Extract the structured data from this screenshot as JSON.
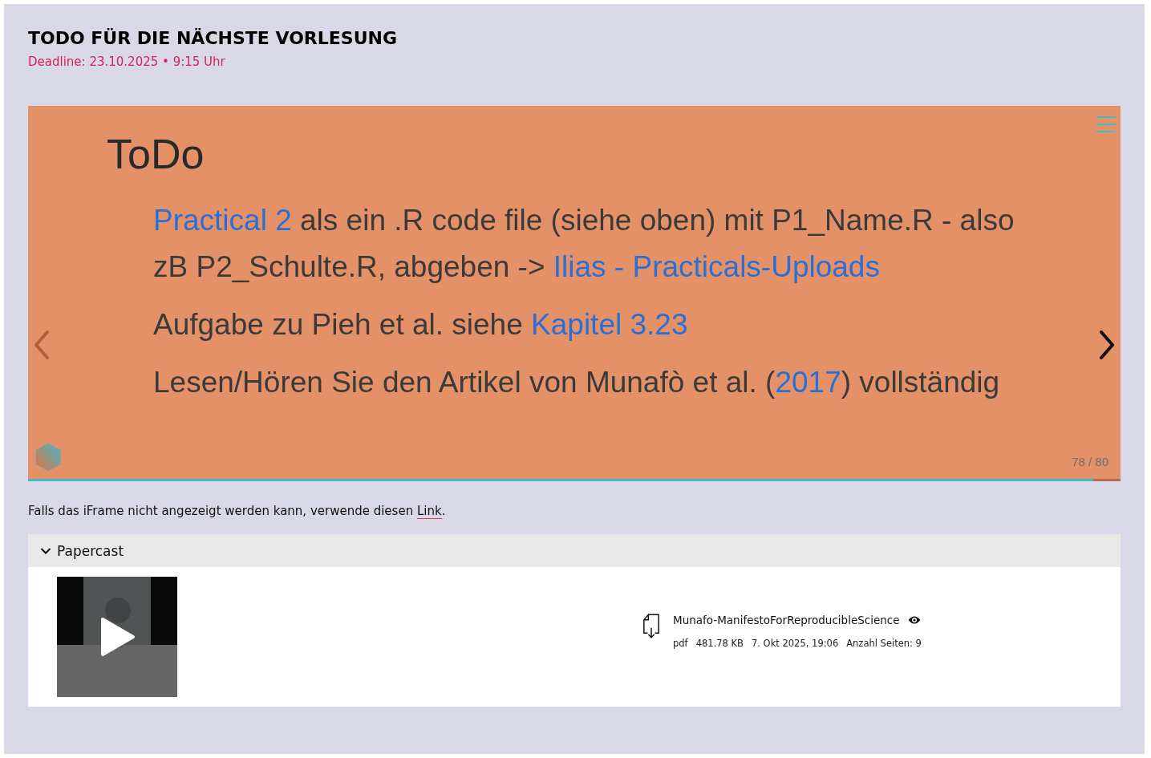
{
  "header": {
    "title": "TODO FÜR DIE NÄCHSTE VORLESUNG",
    "deadline": "Deadline: 23.10.2025 • 9:15 Uhr"
  },
  "slide": {
    "heading": "ToDo",
    "paragraphs": [
      [
        {
          "kind": "link",
          "text": "Practical 2"
        },
        {
          "kind": "text",
          "text": " als ein .R code file (siehe oben) mit P1_Name.R - also zB P2_Schulte.R, abgeben -> "
        },
        {
          "kind": "link",
          "text": "Ilias - Practicals-Uploads"
        }
      ],
      [
        {
          "kind": "text",
          "text": "Aufgabe zu Pieh et al. siehe "
        },
        {
          "kind": "link",
          "text": "Kapitel 3.23"
        }
      ],
      [
        {
          "kind": "text",
          "text": "Lesen/Hören Sie den Artikel von Munafò et al. ("
        },
        {
          "kind": "link",
          "text": "2017"
        },
        {
          "kind": "text",
          "text": ") vollständig"
        }
      ]
    ],
    "counter": "78 / 80",
    "progress": {
      "level": 0.975
    }
  },
  "fallback": {
    "before": "Falls das iFrame nicht angezeigt werden kann, verwende diesen ",
    "link": "Link",
    "after": "."
  },
  "papercast": {
    "title": "Papercast",
    "expanded": true,
    "file": {
      "name": "Munafo-ManifestoForReproducibleScience",
      "type": "pdf",
      "size": "481.78 KB",
      "date": "7. Okt 2025, 19:06",
      "pages": "Anzahl Seiten: 9"
    }
  }
}
